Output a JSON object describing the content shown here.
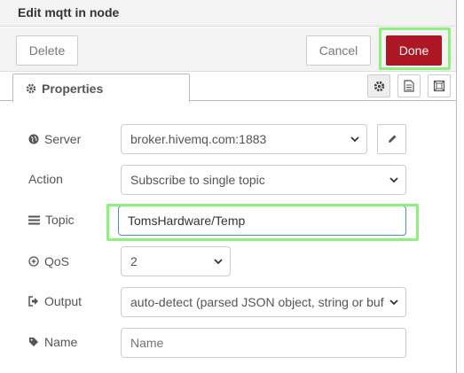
{
  "dialog": {
    "title": "Edit mqtt in node",
    "delete_label": "Delete",
    "cancel_label": "Cancel",
    "done_label": "Done"
  },
  "tabs": {
    "properties_label": "Properties",
    "icons": [
      "gear-icon",
      "document-icon",
      "frame-icon"
    ]
  },
  "form": {
    "server": {
      "label": "Server",
      "value": "broker.hivemq.com:1883",
      "icon": "globe-icon"
    },
    "action": {
      "label": "Action",
      "value": "Subscribe to single topic"
    },
    "topic": {
      "label": "Topic",
      "value": "TomsHardware/Temp",
      "icon": "list-icon"
    },
    "qos": {
      "label": "QoS",
      "value": "2",
      "icon": "qos-icon"
    },
    "output": {
      "label": "Output",
      "value": "auto-detect (parsed JSON object, string or buf",
      "icon": "sign-out-icon"
    },
    "name": {
      "label": "Name",
      "placeholder": "Name",
      "value": "",
      "icon": "tag-icon"
    }
  },
  "colors": {
    "done_button": "#ad1625",
    "highlight": "#8ef07d",
    "panel_bg": "#f3f3f3"
  }
}
